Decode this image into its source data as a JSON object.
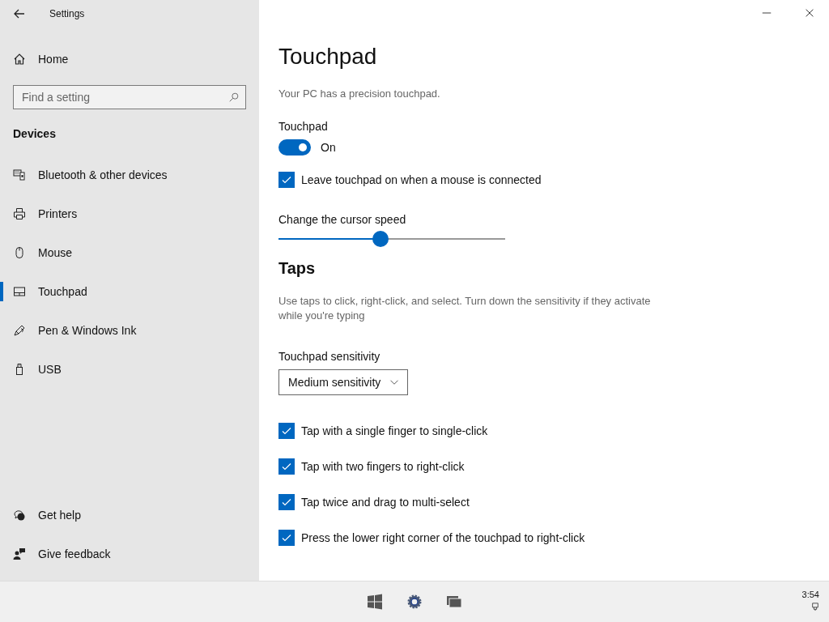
{
  "window": {
    "title": "Settings"
  },
  "sidebar": {
    "home": "Home",
    "search": {
      "placeholder": "Find a setting"
    },
    "section": "Devices",
    "items": [
      {
        "label": "Bluetooth & other devices",
        "kind": "bluetooth",
        "selected": false
      },
      {
        "label": "Printers",
        "kind": "printer",
        "selected": false
      },
      {
        "label": "Mouse",
        "kind": "mouse",
        "selected": false
      },
      {
        "label": "Touchpad",
        "kind": "touchpad",
        "selected": true
      },
      {
        "label": "Pen & Windows Ink",
        "kind": "pen",
        "selected": false
      },
      {
        "label": "USB",
        "kind": "usb",
        "selected": false
      }
    ],
    "footer": [
      {
        "label": "Get help",
        "kind": "help"
      },
      {
        "label": "Give feedback",
        "kind": "feedback"
      }
    ]
  },
  "page": {
    "title": "Touchpad",
    "description": "Your PC has a precision touchpad.",
    "toggle": {
      "label": "Touchpad",
      "on": true,
      "state_text": "On"
    },
    "mouse_checkbox": {
      "label": "Leave touchpad on when a mouse is connected",
      "checked": true
    },
    "cursor_speed": {
      "label": "Change the cursor speed",
      "level": 0.45
    },
    "taps": {
      "heading": "Taps",
      "description": "Use taps to click, right-click, and select. Turn down the sensitivity if they activate while you're typing",
      "sensitivity_label": "Touchpad sensitivity",
      "sensitivity_value": "Medium sensitivity",
      "options": [
        {
          "label": "Tap with a single finger to single-click",
          "checked": true
        },
        {
          "label": "Tap with two fingers to right-click",
          "checked": true
        },
        {
          "label": "Tap twice and drag to multi-select",
          "checked": true
        },
        {
          "label": "Press the lower right corner of the touchpad to right-click",
          "checked": true
        }
      ]
    }
  },
  "taskbar": {
    "time": "3:54"
  }
}
